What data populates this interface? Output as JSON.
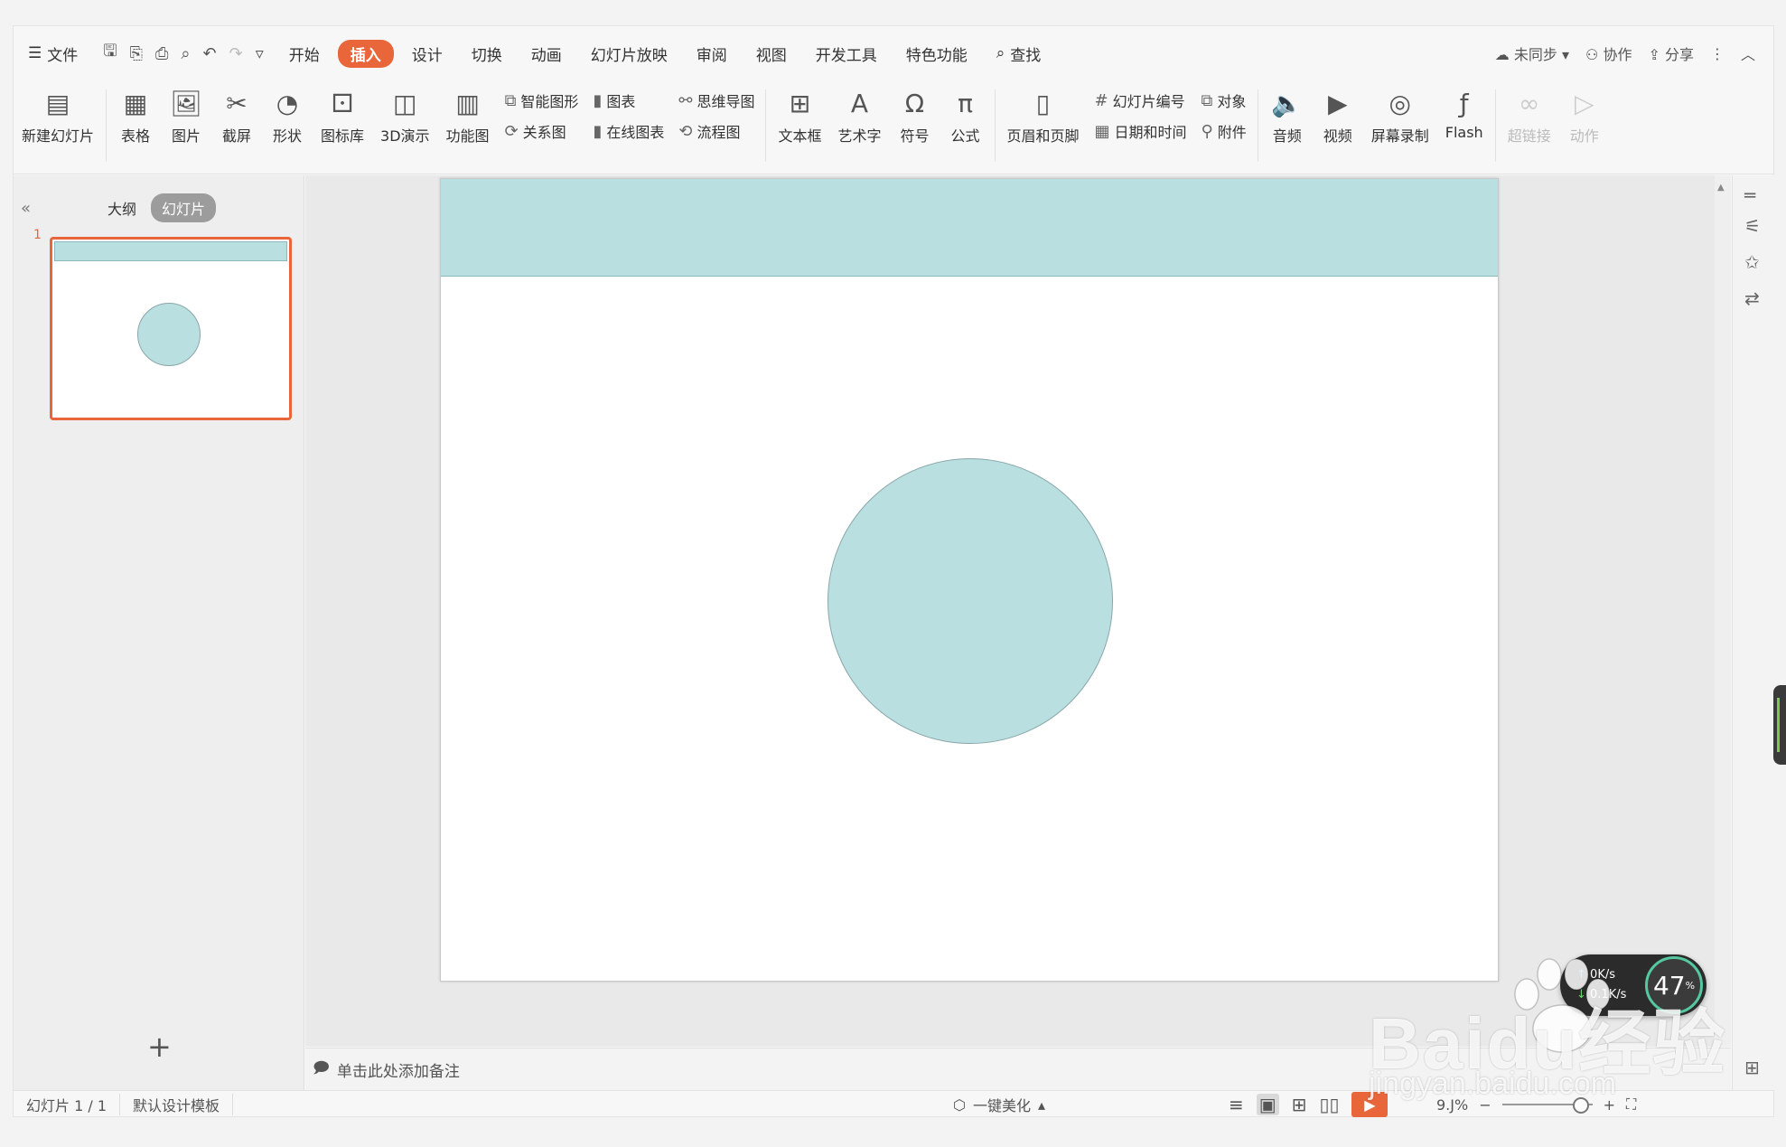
{
  "menu": {
    "file": "文件",
    "tabs": [
      "开始",
      "插入",
      "设计",
      "切换",
      "动画",
      "幻灯片放映",
      "审阅",
      "视图",
      "开发工具",
      "特色功能"
    ],
    "active_tab": "插入",
    "search": "查找",
    "sync": "未同步",
    "collab": "协作",
    "share": "分享"
  },
  "ribbon": {
    "new_slide": "新建幻灯片",
    "table": "表格",
    "picture": "图片",
    "screenshot": "截屏",
    "shape": "形状",
    "icon_lib": "图标库",
    "demo3d": "3D演示",
    "func_chart": "功能图",
    "smart_shape": "智能图形",
    "chart": "图表",
    "mind_map": "思维导图",
    "relation": "关系图",
    "online_chart": "在线图表",
    "flowchart": "流程图",
    "textbox": "文本框",
    "art_text": "艺术字",
    "symbol": "符号",
    "formula": "公式",
    "header_footer": "页眉和页脚",
    "slide_number": "幻灯片编号",
    "object": "对象",
    "datetime": "日期和时间",
    "attachment": "附件",
    "audio": "音频",
    "video": "视频",
    "screen_record": "屏幕录制",
    "flash": "Flash",
    "hyperlink": "超链接",
    "action": "动作"
  },
  "left_panel": {
    "tab_outline": "大纲",
    "tab_slides": "幻灯片",
    "slide_number": "1"
  },
  "notes_placeholder": "单击此处添加备注",
  "status": {
    "slide_info": "幻灯片 1 / 1",
    "template": "默认设计模板",
    "beautify": "一键美化",
    "zoom": "9.J%"
  },
  "net_widget": {
    "up_speed": "0K/s",
    "down_speed": "0.1K/s",
    "percent": "47"
  },
  "watermark": {
    "brand": "Baidu经验",
    "url": "jingyan.baidu.com"
  },
  "colors": {
    "accent": "#e8663a",
    "shape_fill": "#b9dfe1"
  }
}
